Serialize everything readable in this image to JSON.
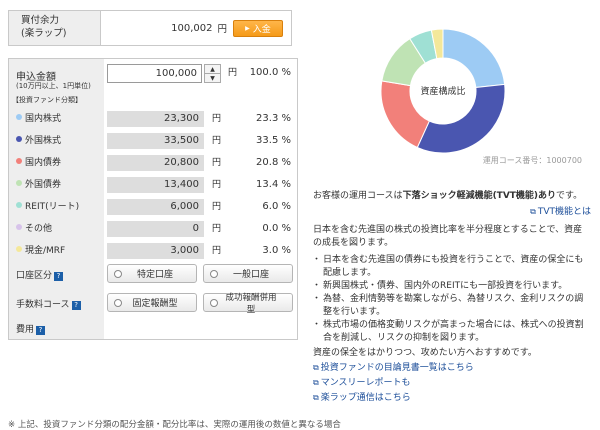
{
  "buy_power": {
    "label_line1": "買付余力",
    "label_line2": "(楽ラップ)",
    "amount": "100,002",
    "unit": "円",
    "deposit_label": "入金"
  },
  "application": {
    "label": "申込金額",
    "sub_label": "(10万円以上、1円単位)",
    "amount_value": "100,000",
    "unit": "円",
    "percent": "100.0 %"
  },
  "fund_section_label": "【投資ファンド分類】",
  "funds": [
    {
      "name": "国内株式",
      "amount": "23,300",
      "unit": "円",
      "percent": "23.3 %",
      "color": "#9dcbf4"
    },
    {
      "name": "外国株式",
      "amount": "33,500",
      "unit": "円",
      "percent": "33.5 %",
      "color": "#4a56b0"
    },
    {
      "name": "国内債券",
      "amount": "20,800",
      "unit": "円",
      "percent": "20.8 %",
      "color": "#f2807a"
    },
    {
      "name": "外国債券",
      "amount": "13,400",
      "unit": "円",
      "percent": "13.4 %",
      "color": "#bfe3b4"
    },
    {
      "name": "REIT(リート)",
      "amount": "6,000",
      "unit": "円",
      "percent": "6.0 %",
      "color": "#9fe0d4"
    },
    {
      "name": "その他",
      "amount": "0",
      "unit": "円",
      "percent": "0.0 %",
      "color": "#d7c3ea"
    },
    {
      "name": "現金/MRF",
      "amount": "3,000",
      "unit": "円",
      "percent": "3.0 %",
      "color": "#f4e89a"
    }
  ],
  "account": {
    "label": "口座区分",
    "help_icon": "?",
    "option1": "特定口座",
    "option2": "一般口座"
  },
  "fee": {
    "label": "手数料コース",
    "help_icon": "?",
    "option1": "固定報酬型",
    "option2": "成功報酬併用型"
  },
  "cost_label": "費用",
  "cost_help_icon": "?",
  "donut": {
    "center_label": "資産構成比",
    "course_number": "運用コース番号：1000700"
  },
  "chart_data": {
    "type": "pie",
    "title": "資産構成比",
    "categories": [
      "国内株式",
      "外国株式",
      "国内債券",
      "外国債券",
      "REIT(リート)",
      "その他",
      "現金/MRF"
    ],
    "values": [
      23.3,
      33.5,
      20.8,
      13.4,
      6.0,
      0.0,
      3.0
    ],
    "colors": [
      "#9dcbf4",
      "#4a56b0",
      "#f2807a",
      "#bfe3b4",
      "#9fe0d4",
      "#d7c3ea",
      "#f4e89a"
    ]
  },
  "description": {
    "line1_prefix": "お客様の運用コースは",
    "line1_highlight": "下落ショック軽減機能(TVT機能)あり",
    "line1_suffix": "です。",
    "tvt_link": "TVT機能とは",
    "para2": "日本を含む先進国の株式の投資比率を半分程度とすることで、資産の成長を図ります。",
    "bullets": [
      "日本を含む先進国の債券にも投資を行うことで、資産の保全にも配慮します。",
      "新興国株式・債券、国内外のREITにも一部投資を行います。",
      "為替、金利情勢等を勘案しながら、為替リスク、金利リスクの調整を行います。",
      "株式市場の価格変動リスクが高まった場合には、株式への投資割合を削減し、リスクの抑制を図ります。"
    ],
    "para3": "資産の保全をはかりつつ、攻めたい方へおすすめです。",
    "links": [
      "投資ファンドの目論見書一覧はこちら",
      "マンスリーレポートも",
      "楽ラップ通信はこちら"
    ]
  },
  "footnote": "※ 上記、投資ファンド分類の配分金額・配分比率は、実際の運用後の数値と異なる場合"
}
